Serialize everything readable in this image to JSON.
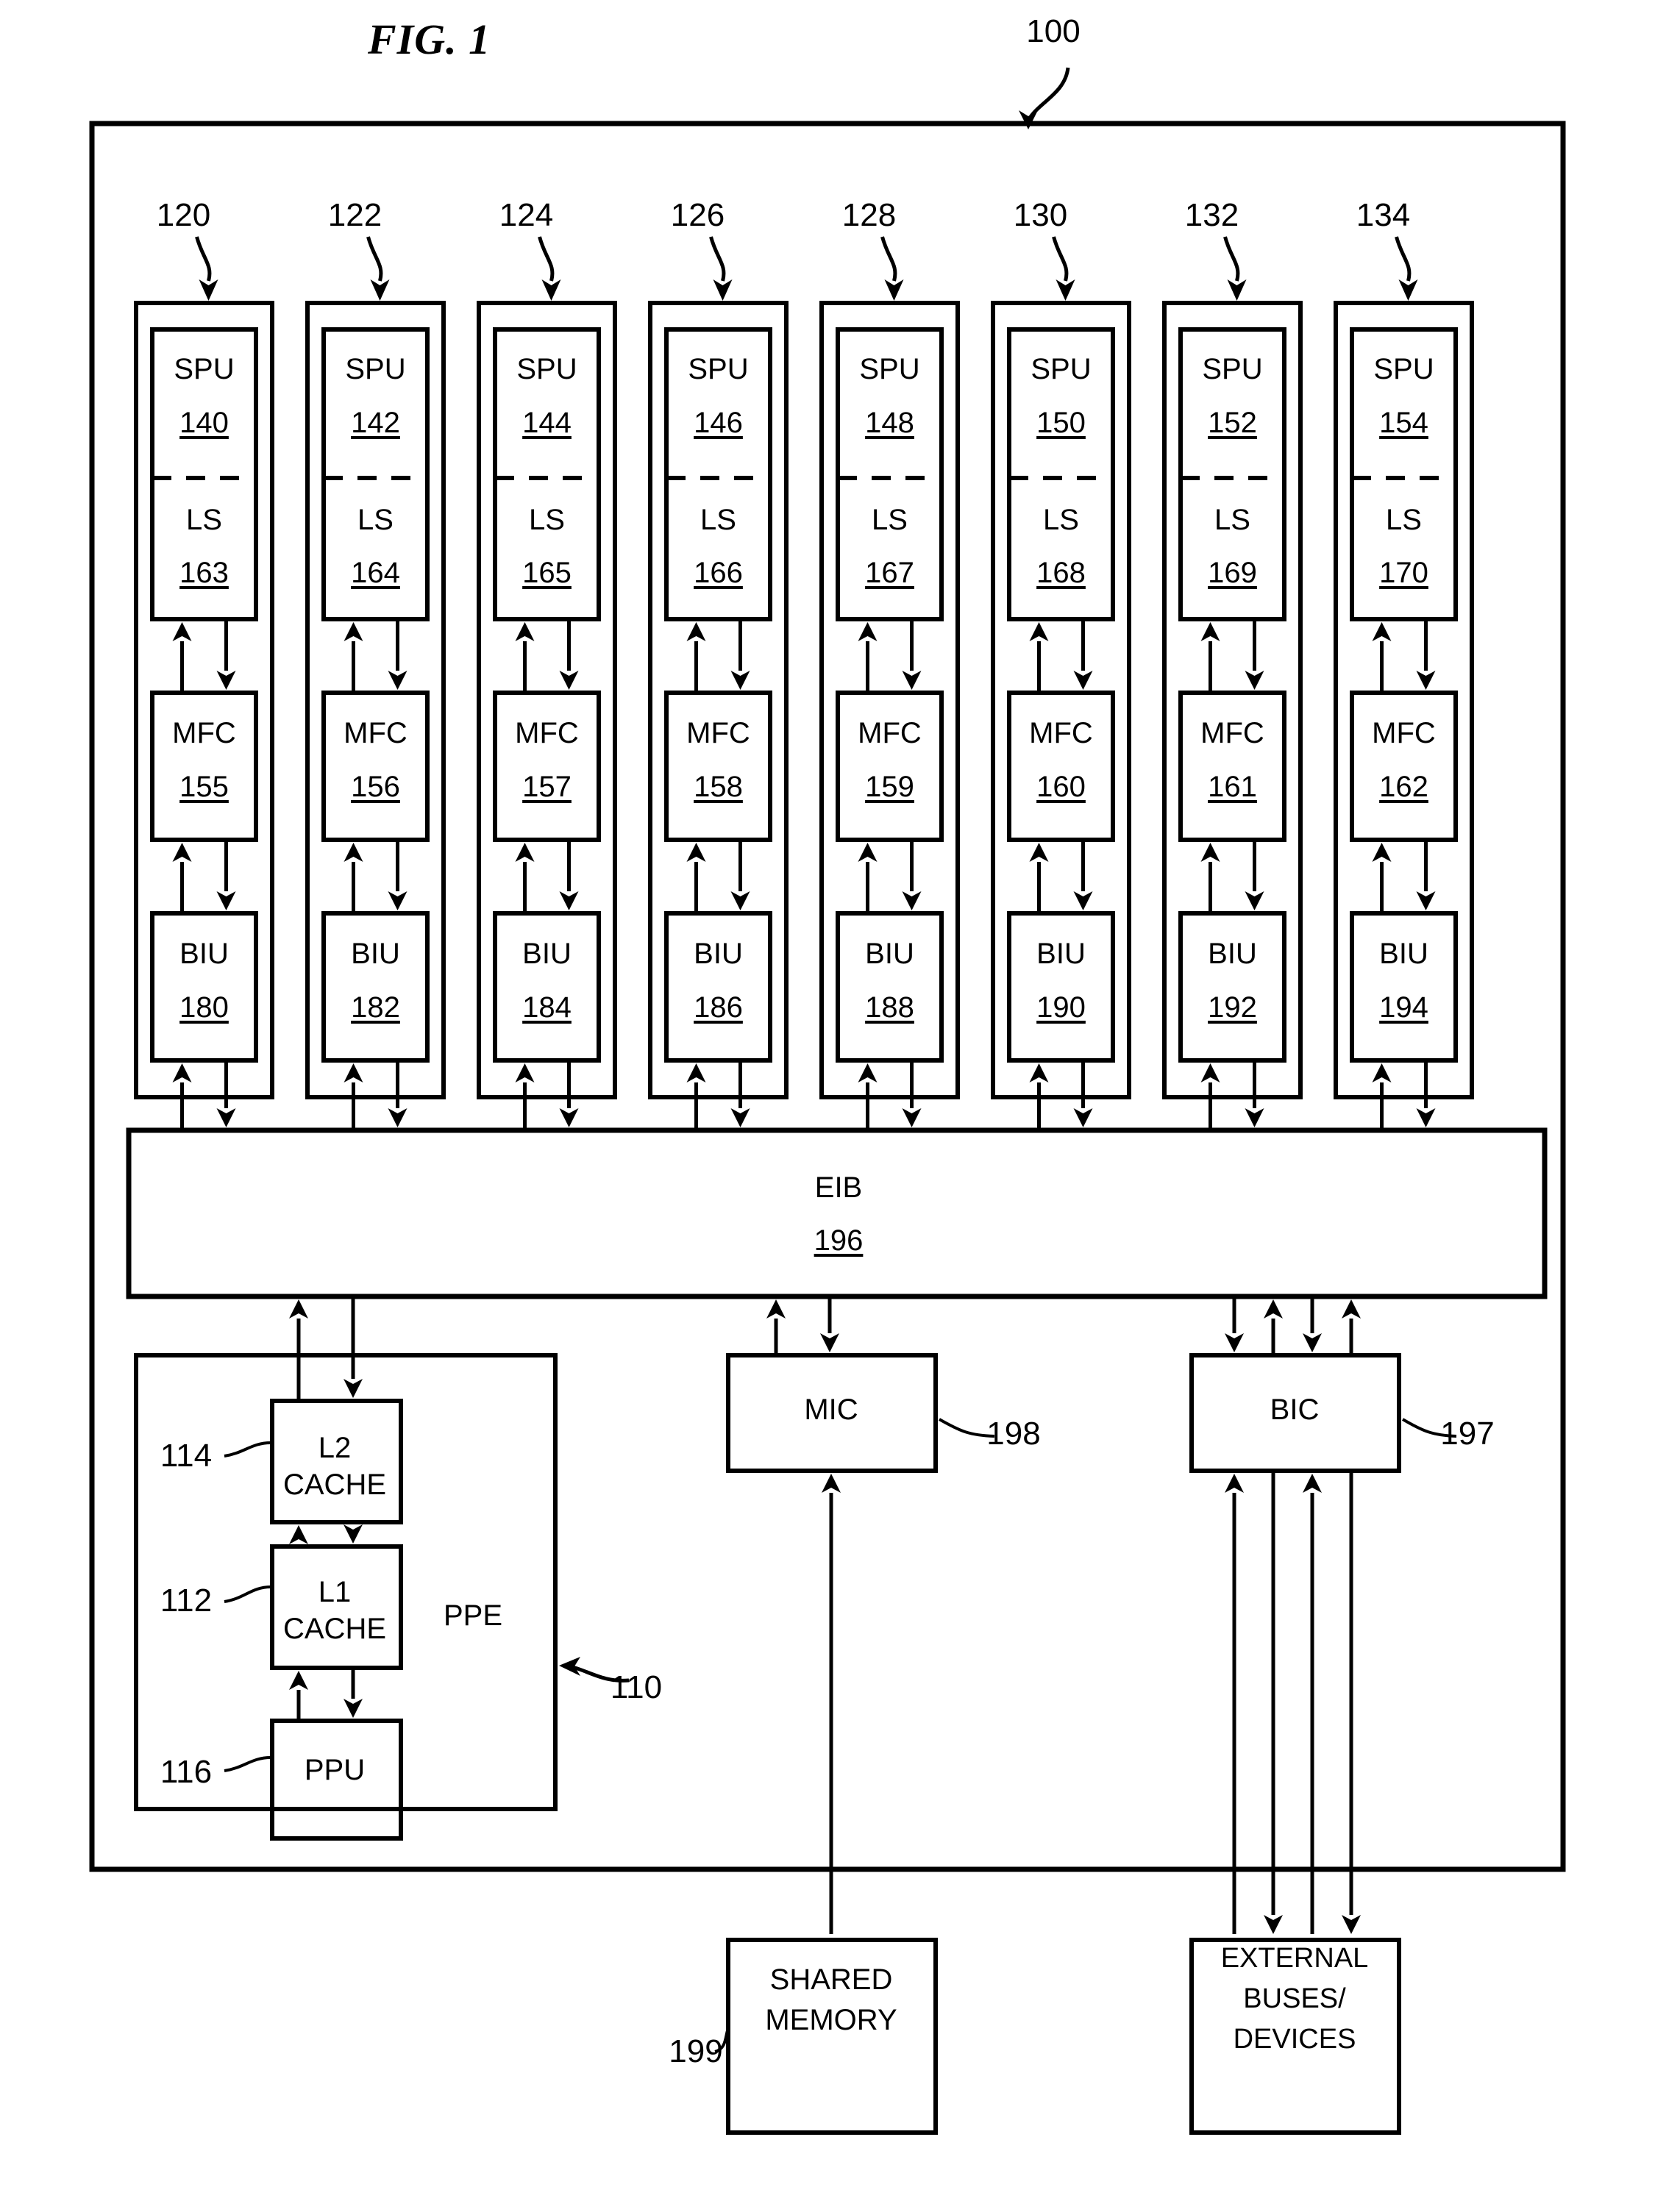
{
  "figure": {
    "title": "FIG. 1",
    "system_ref": "100"
  },
  "spe_refs": [
    "120",
    "122",
    "124",
    "126",
    "128",
    "130",
    "132",
    "134"
  ],
  "spes": [
    {
      "spu_label": "SPU",
      "spu_ref": "140",
      "ls_label": "LS",
      "ls_ref": "163",
      "mfc_label": "MFC",
      "mfc_ref": "155",
      "biu_label": "BIU",
      "biu_ref": "180"
    },
    {
      "spu_label": "SPU",
      "spu_ref": "142",
      "ls_label": "LS",
      "ls_ref": "164",
      "mfc_label": "MFC",
      "mfc_ref": "156",
      "biu_label": "BIU",
      "biu_ref": "182"
    },
    {
      "spu_label": "SPU",
      "spu_ref": "144",
      "ls_label": "LS",
      "ls_ref": "165",
      "mfc_label": "MFC",
      "mfc_ref": "157",
      "biu_label": "BIU",
      "biu_ref": "184"
    },
    {
      "spu_label": "SPU",
      "spu_ref": "146",
      "ls_label": "LS",
      "ls_ref": "166",
      "mfc_label": "MFC",
      "mfc_ref": "158",
      "biu_label": "BIU",
      "biu_ref": "186"
    },
    {
      "spu_label": "SPU",
      "spu_ref": "148",
      "ls_label": "LS",
      "ls_ref": "167",
      "mfc_label": "MFC",
      "mfc_ref": "159",
      "biu_label": "BIU",
      "biu_ref": "188"
    },
    {
      "spu_label": "SPU",
      "spu_ref": "150",
      "ls_label": "LS",
      "ls_ref": "168",
      "mfc_label": "MFC",
      "mfc_ref": "160",
      "biu_label": "BIU",
      "biu_ref": "190"
    },
    {
      "spu_label": "SPU",
      "spu_ref": "152",
      "ls_label": "LS",
      "ls_ref": "169",
      "mfc_label": "MFC",
      "mfc_ref": "161",
      "biu_label": "BIU",
      "biu_ref": "192"
    },
    {
      "spu_label": "SPU",
      "spu_ref": "154",
      "ls_label": "LS",
      "ls_ref": "170",
      "mfc_label": "MFC",
      "mfc_ref": "162",
      "biu_label": "BIU",
      "biu_ref": "194"
    }
  ],
  "eib": {
    "label": "EIB",
    "ref": "196"
  },
  "ppe": {
    "label": "PPE",
    "ref": "110",
    "l2": {
      "line1": "L2",
      "line2": "CACHE",
      "ref": "114"
    },
    "l1": {
      "line1": "L1",
      "line2": "CACHE",
      "ref": "112"
    },
    "ppu": {
      "label": "PPU",
      "ref": "116"
    }
  },
  "mic": {
    "label": "MIC",
    "ref": "198"
  },
  "bic": {
    "label": "BIC",
    "ref": "197"
  },
  "shared_memory": {
    "line1": "SHARED",
    "line2": "MEMORY",
    "ref": "199"
  },
  "external": {
    "line1": "EXTERNAL",
    "line2": "BUSES/",
    "line3": "DEVICES"
  }
}
